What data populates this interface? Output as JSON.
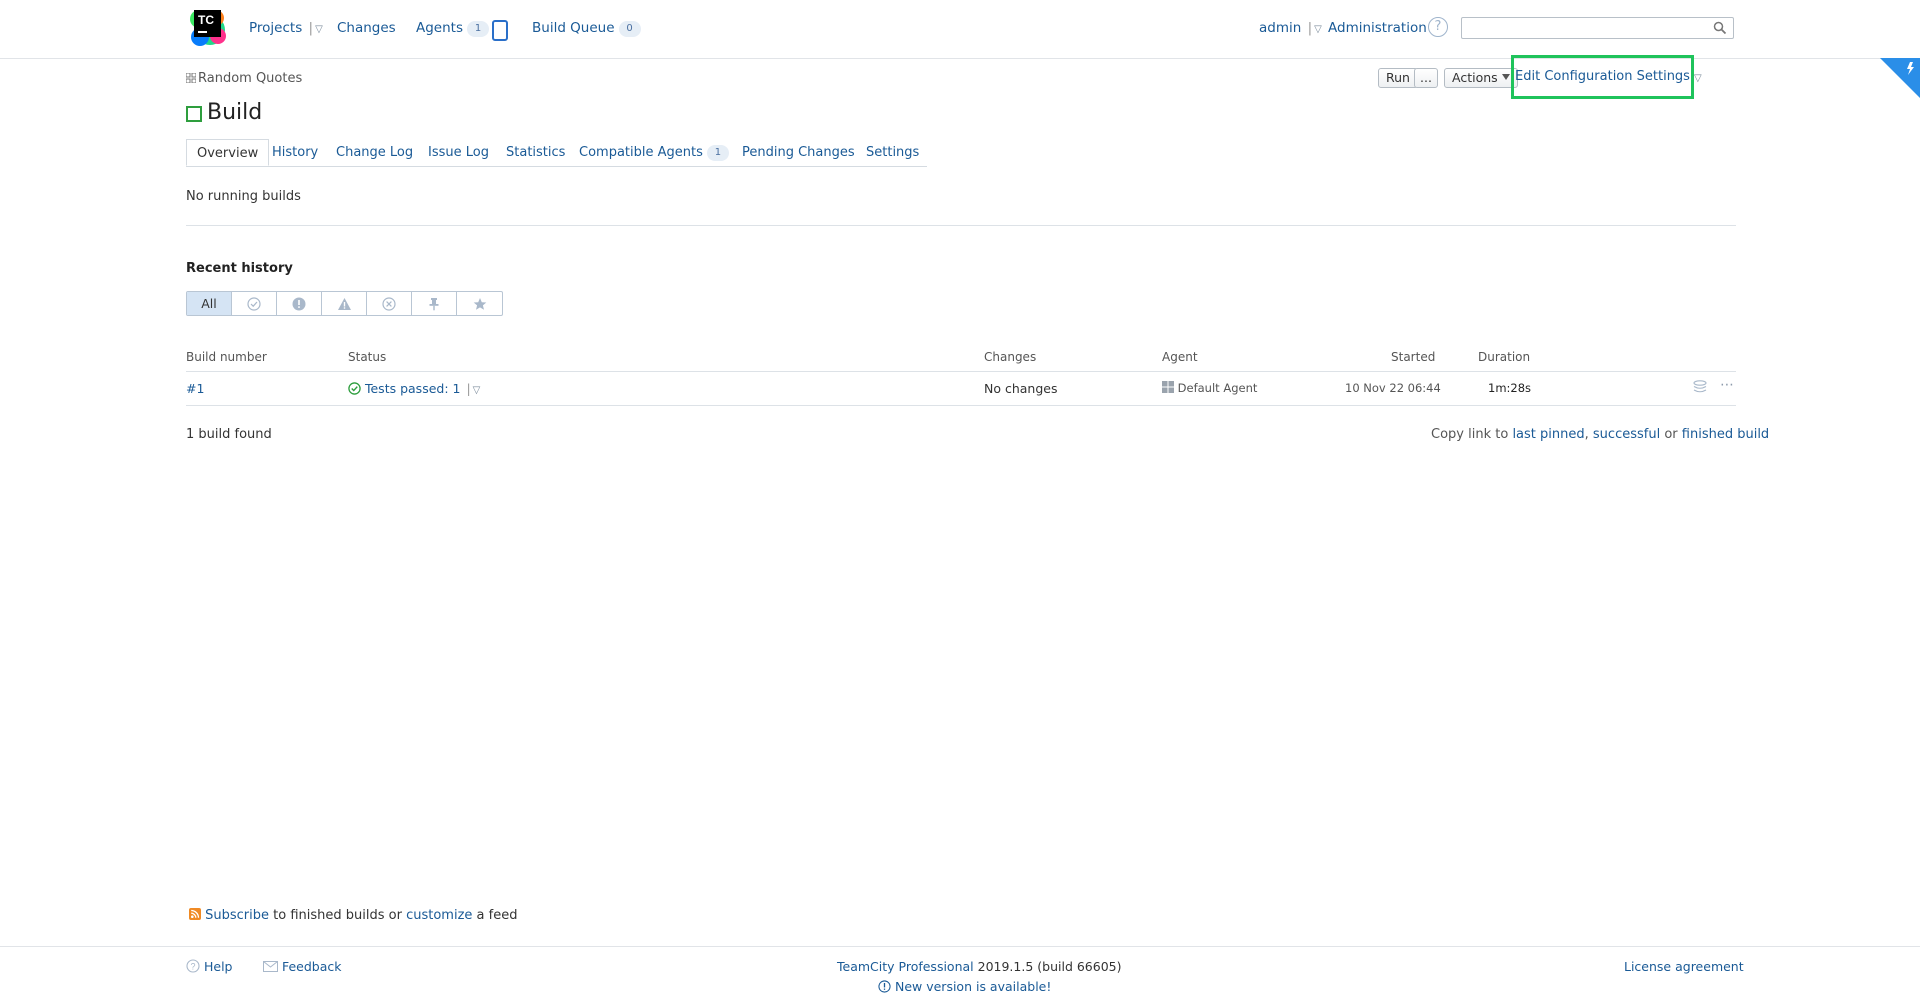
{
  "header": {
    "nav": {
      "projects": "Projects",
      "changes": "Changes",
      "agents": "Agents",
      "agents_count": "1",
      "build_queue": "Build Queue",
      "build_queue_count": "0"
    },
    "user": "admin",
    "administration": "Administration",
    "help": "?",
    "search": {
      "placeholder": "",
      "value": ""
    }
  },
  "breadcrumb": {
    "project": "Random Quotes"
  },
  "toolbar": {
    "run": "Run",
    "run_more": "...",
    "actions": "Actions",
    "edit_settings": "Edit Configuration Settings"
  },
  "page": {
    "title": "Build",
    "tabs": [
      {
        "label": "Overview"
      },
      {
        "label": "History"
      },
      {
        "label": "Change Log"
      },
      {
        "label": "Issue Log"
      },
      {
        "label": "Statistics"
      },
      {
        "label": "Compatible Agents",
        "count": "1"
      },
      {
        "label": "Pending Changes"
      },
      {
        "label": "Settings"
      }
    ],
    "running_builds": "No running builds",
    "recent_history": "Recent history",
    "filter": {
      "all": "All"
    }
  },
  "table": {
    "columns": [
      "Build number",
      "Status",
      "Changes",
      "Agent",
      "Started",
      "Duration"
    ],
    "rows": [
      {
        "number": "#1",
        "status": "Tests passed: 1",
        "changes": "No changes",
        "agent": "Default Agent",
        "started": "10 Nov 22 06:44",
        "duration": "1m:28s"
      }
    ],
    "found": "1 build found",
    "copy_link": {
      "prefix": "Copy link to",
      "last_pinned": "last pinned",
      "comma": ",",
      "successful": "successful",
      "or": "or",
      "finished": "finished build"
    }
  },
  "feed": {
    "subscribe": "Subscribe",
    "text1": "to finished builds or",
    "customize": "customize",
    "text2": "a feed"
  },
  "footer": {
    "help": "Help",
    "feedback": "Feedback",
    "product": "TeamCity Professional",
    "version": "2019.1.5 (build 66605)",
    "new_version": "New version is available!",
    "license": "License agreement"
  },
  "colors": {
    "link": "#1a5a96",
    "success": "#2e9e3e",
    "highlight": "#1fc35b",
    "ribbon": "#2a8ee8"
  }
}
